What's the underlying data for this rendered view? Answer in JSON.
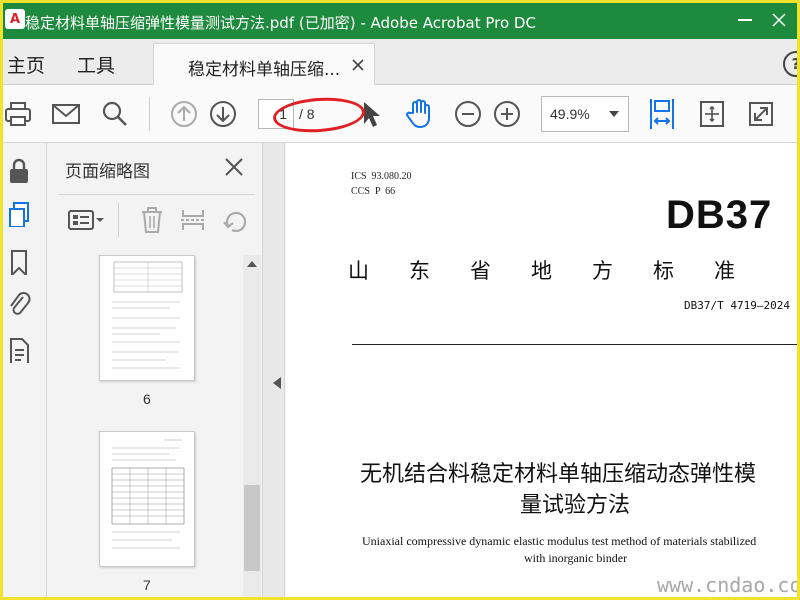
{
  "window": {
    "title": "稳定材料单轴压缩弹性模量测试方法.pdf (已加密) - Adobe Acrobat Pro DC",
    "logo_text": "A"
  },
  "tabs": {
    "home": "主页",
    "tools": "工具",
    "doc_tab": "稳定材料单轴压缩..."
  },
  "toolbar": {
    "page_current": "1",
    "page_total": "/ 8",
    "zoom": "49.9%"
  },
  "thumbnail_panel": {
    "title": "页面缩略图",
    "thumbs": [
      {
        "label": "6"
      },
      {
        "label": "7"
      }
    ]
  },
  "document": {
    "ics": "ICS  93.080.20",
    "ccs": "CCS  P  66",
    "db_code": "DB37",
    "region": "山东省地方标准",
    "std_number": "DB37/T 4719—2024",
    "title_line1": "无机结合料稳定材料单轴压缩动态弹性模",
    "title_line2": "量试验方法",
    "english_line1": "Uniaxial compressive dynamic elastic modulus test method of materials stabilized",
    "english_line2": "with inorganic binder"
  },
  "watermark": "www.cndao.com",
  "colors": {
    "titlebar": "#1e8a3d",
    "accent_blue": "#1473e6",
    "annotation_red": "#e31e24",
    "border_yellow": "#f1e22b"
  }
}
